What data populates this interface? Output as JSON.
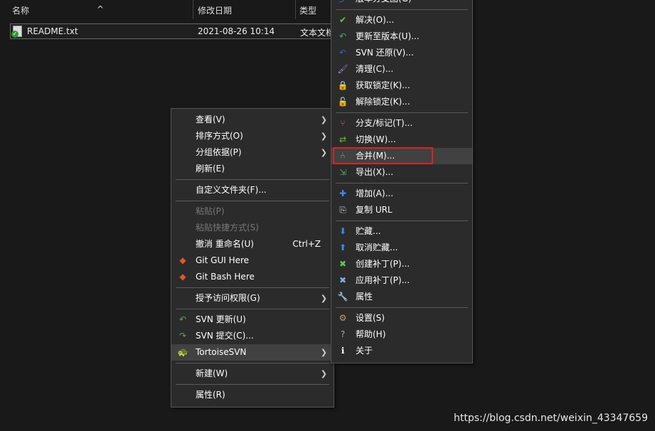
{
  "explorer": {
    "columns": [
      "名称",
      "修改日期",
      "类型"
    ],
    "files": [
      {
        "name": "README.txt",
        "modified": "2021-08-26 10:14",
        "type": "文本文档"
      }
    ]
  },
  "context_menu": [
    {
      "label": "查看(V)",
      "submenu": true
    },
    {
      "label": "排序方式(O)",
      "submenu": true
    },
    {
      "label": "分组依据(P)",
      "submenu": true
    },
    {
      "label": "刷新(E)"
    },
    {
      "sep": true
    },
    {
      "label": "自定义文件夹(F)..."
    },
    {
      "sep": true
    },
    {
      "label": "粘贴(P)",
      "disabled": true
    },
    {
      "label": "粘贴快捷方式(S)",
      "disabled": true
    },
    {
      "label": "撤消 重命名(U)",
      "shortcut": "Ctrl+Z"
    },
    {
      "label": "Git GUI Here",
      "icon": "git-icon"
    },
    {
      "label": "Git Bash Here",
      "icon": "git-icon"
    },
    {
      "sep": true
    },
    {
      "label": "授予访问权限(G)",
      "submenu": true
    },
    {
      "sep": true
    },
    {
      "label": "SVN 更新(U)",
      "icon": "svn-update-icon"
    },
    {
      "label": "SVN 提交(C)...",
      "icon": "svn-commit-icon"
    },
    {
      "label": "TortoiseSVN",
      "icon": "tortoisesvn-icon",
      "submenu": true,
      "highlighted": true
    },
    {
      "sep": true
    },
    {
      "label": "新建(W)",
      "submenu": true
    },
    {
      "sep": true
    },
    {
      "label": "属性(R)"
    }
  ],
  "tortoise_submenu": [
    {
      "label": "版本分支图(G)",
      "icon": "revision-graph-icon"
    },
    {
      "sep": true
    },
    {
      "label": "解决(O)...",
      "icon": "resolve-icon"
    },
    {
      "label": "更新至版本(U)...",
      "icon": "update-to-revision-icon"
    },
    {
      "label": "SVN 还原(V)...",
      "icon": "revert-icon"
    },
    {
      "label": "清理(C)...",
      "icon": "cleanup-icon"
    },
    {
      "label": "获取锁定(K)...",
      "icon": "lock-icon"
    },
    {
      "label": "解除锁定(K)...",
      "icon": "unlock-icon"
    },
    {
      "sep": true
    },
    {
      "label": "分支/标记(T)...",
      "icon": "branch-icon"
    },
    {
      "label": "切换(W)...",
      "icon": "switch-icon"
    },
    {
      "label": "合并(M)...",
      "icon": "merge-icon",
      "highlighted": true
    },
    {
      "label": "导出(X)...",
      "icon": "export-icon"
    },
    {
      "sep": true
    },
    {
      "label": "增加(A)...",
      "icon": "add-icon"
    },
    {
      "label": "复制 URL",
      "icon": "copy-url-icon"
    },
    {
      "sep": true
    },
    {
      "label": "贮藏...",
      "icon": "shelve-icon"
    },
    {
      "label": "取消贮藏...",
      "icon": "unshelve-icon"
    },
    {
      "label": "创建补丁(P)...",
      "icon": "create-patch-icon"
    },
    {
      "label": "应用补丁(P)...",
      "icon": "apply-patch-icon"
    },
    {
      "label": "属性",
      "icon": "properties-icon"
    },
    {
      "sep": true
    },
    {
      "label": "设置(S)",
      "icon": "settings-icon"
    },
    {
      "label": "帮助(H)",
      "icon": "help-icon"
    },
    {
      "label": "关于",
      "icon": "about-icon"
    }
  ],
  "watermark": "https://blog.csdn.net/weixin_43347659"
}
